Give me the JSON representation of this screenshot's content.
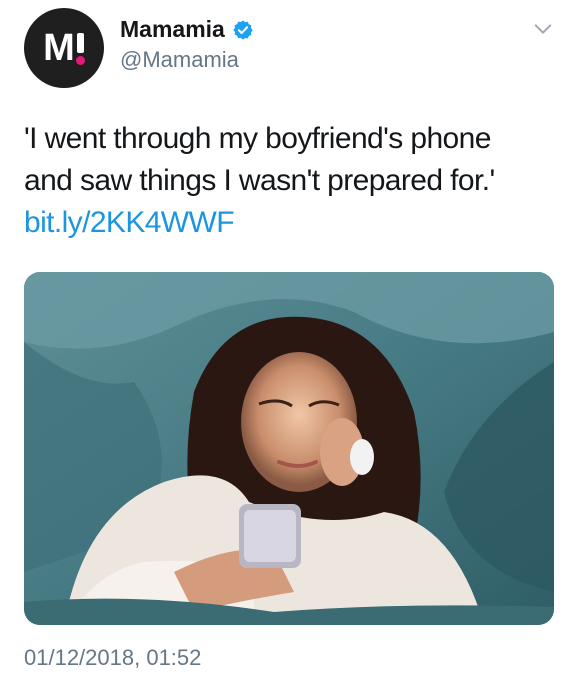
{
  "tweet": {
    "author": {
      "display_name": "Mamamia",
      "handle": "@Mamamia",
      "verified": true,
      "avatar_text": "M"
    },
    "text_line1": "'I went through my boyfriend's phone",
    "text_line2": "and saw things I wasn't prepared for.'",
    "link": "bit.ly/2KK4WWF",
    "timestamp": "01/12/2018, 01:52",
    "media": {
      "alt": "photo"
    }
  },
  "colors": {
    "link": "#1b95e0",
    "secondary_text": "#657786",
    "verified_badge": "#1da1f2",
    "avatar_bg": "#1f1f1f",
    "avatar_accent": "#e5197a"
  },
  "icons": {
    "verified": "verified-badge-icon",
    "menu": "chevron-down-icon"
  }
}
